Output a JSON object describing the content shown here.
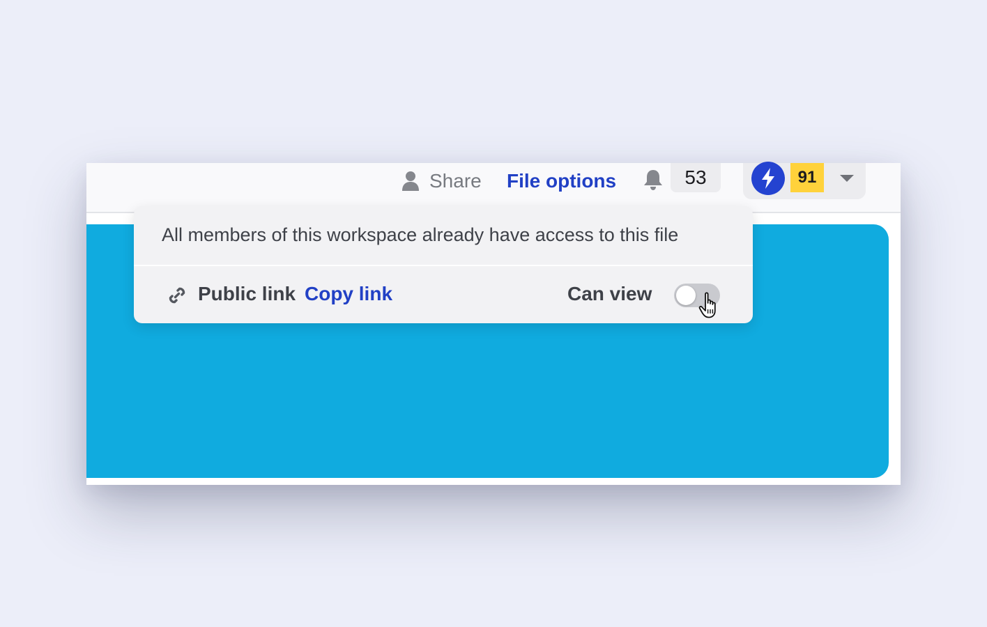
{
  "toolbar": {
    "share_label": "Share",
    "file_options_label": "File options",
    "notification_count": "53",
    "score": "91"
  },
  "popover": {
    "message": "All members of this workspace already have access to this file",
    "public_link_label": "Public link",
    "copy_link_label": "Copy link",
    "permission_label": "Can view",
    "public_link_enabled": false
  },
  "icons": {
    "share": "user-icon",
    "notifications": "bell-icon",
    "avatar": "lightning-bolt-icon",
    "menu": "caret-down-icon",
    "public_link": "link-icon",
    "pointer": "hand-cursor-icon"
  },
  "colors": {
    "accent": "#2140c5",
    "canvas": "#10abdf",
    "score_badge": "#ffd23b",
    "avatar": "#2443d0",
    "background": "#eceef9"
  }
}
